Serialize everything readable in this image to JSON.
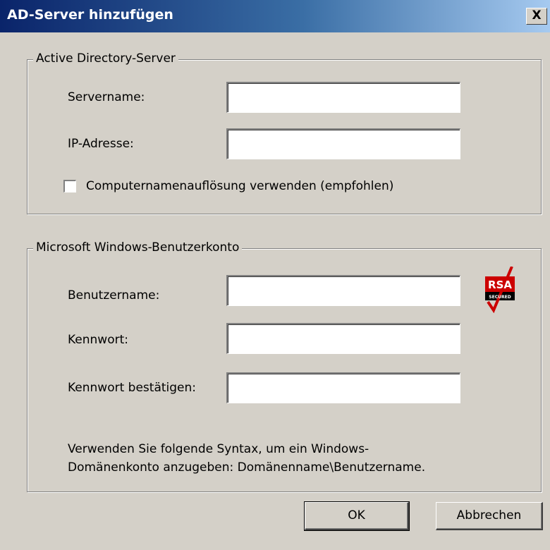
{
  "window": {
    "title": "AD-Server hinzufügen",
    "close_label": "X"
  },
  "server_group": {
    "legend": "Active Directory-Server",
    "servername_label": "Servername:",
    "servername_value": "",
    "ip_label": "IP-Adresse:",
    "ip_value": "",
    "resolve_checkbox_label": "Computernamenauflösung verwenden (empfohlen)",
    "resolve_checkbox_checked": false
  },
  "account_group": {
    "legend": "Microsoft Windows-Benutzerkonto",
    "username_label": "Benutzername:",
    "username_value": "",
    "password_label": "Kennwort:",
    "password_value": "",
    "confirm_label": "Kennwort bestätigen:",
    "confirm_value": "",
    "hint_line1": "Verwenden Sie folgende Syntax, um ein Windows-",
    "hint_line2": "Domänenkonto anzugeben: Domänenname\\Benutzername.",
    "logo_text": "RSA",
    "logo_subtext": "SECURED"
  },
  "buttons": {
    "ok": "OK",
    "cancel": "Abbrechen"
  },
  "colors": {
    "dialog_bg": "#d4d0c8",
    "titlebar_start": "#0a246a",
    "titlebar_end": "#a6caf0",
    "logo_red": "#cc0000"
  },
  "icons": {
    "close": "close-icon",
    "logo": "rsa-secured-logo-icon"
  }
}
